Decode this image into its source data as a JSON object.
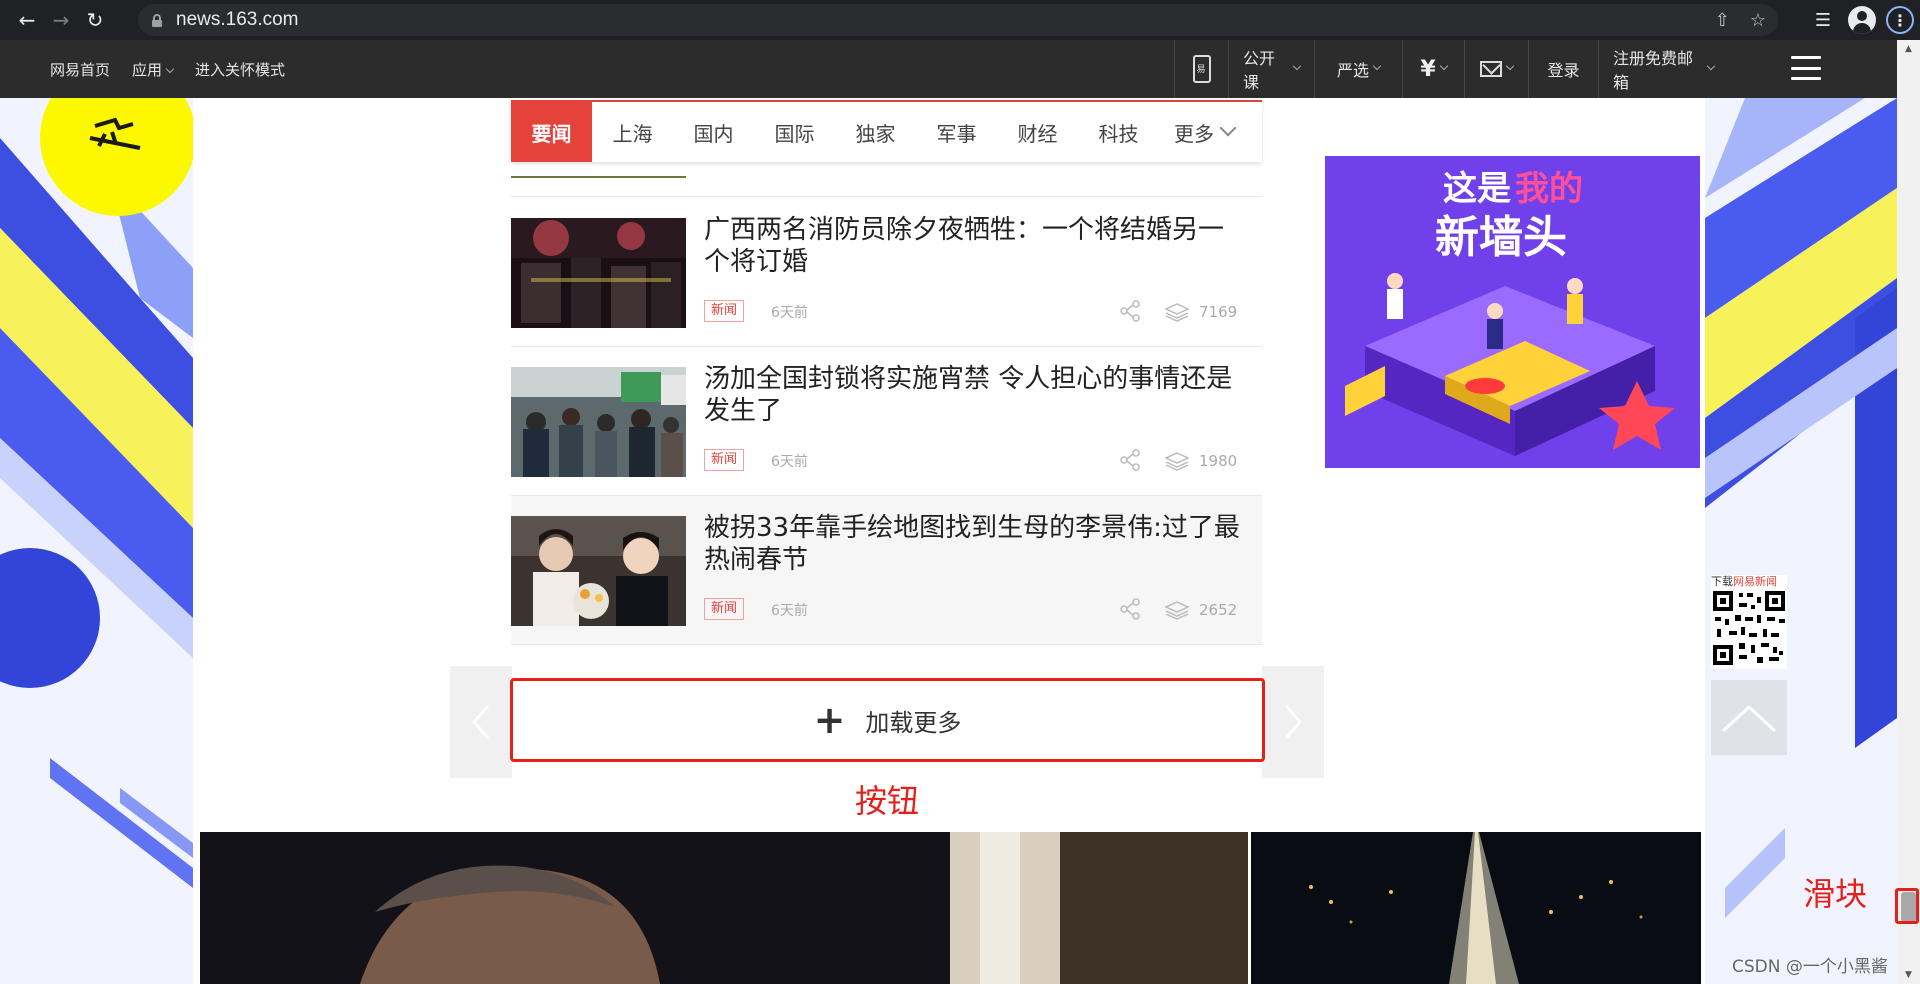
{
  "browser": {
    "url": "news.163.com",
    "icons": [
      "back-icon",
      "forward-icon",
      "reload-icon",
      "lock-icon",
      "share-page-icon",
      "bookmark-star-icon",
      "reading-list-icon",
      "profile-icon",
      "menu-icon"
    ]
  },
  "site_nav": {
    "left_items": [
      {
        "label": "网易首页"
      },
      {
        "label": "应用"
      },
      {
        "label": "进入关怀模式"
      }
    ],
    "right_items": [
      {
        "label": "公开课"
      },
      {
        "label": "严选"
      },
      {
        "label": "登录"
      },
      {
        "label": "注册免费邮箱"
      }
    ]
  },
  "tabs": [
    {
      "label": "要闻",
      "active": true
    },
    {
      "label": "上海"
    },
    {
      "label": "国内"
    },
    {
      "label": "国际"
    },
    {
      "label": "独家"
    },
    {
      "label": "军事"
    },
    {
      "label": "财经"
    },
    {
      "label": "科技"
    },
    {
      "label": "更多"
    }
  ],
  "news": [
    {
      "title": "广西两名消防员除夕夜牺牲：一个将结婚另一个将订婚",
      "tag": "新闻",
      "time": "6天前",
      "views": "7169"
    },
    {
      "title": "汤加全国封锁将实施宵禁 令人担心的事情还是发生了",
      "tag": "新闻",
      "time": "6天前",
      "views": "1980"
    },
    {
      "title": "被拐33年靠手绘地图找到生母的李景伟:过了最热闹春节",
      "tag": "新闻",
      "time": "6天前",
      "views": "2652"
    }
  ],
  "load_more": {
    "label": "加载更多"
  },
  "annotations": {
    "button": "按钮",
    "slider": "滑块"
  },
  "ad": {
    "line1": "这是",
    "line1_hl": "我的",
    "line2": "新墙头"
  },
  "qr": {
    "label_prefix": "下载",
    "label_brand": "网易新闻"
  },
  "watermark": "CSDN @一个小黑酱",
  "colors": {
    "brand_red": "#e5423b",
    "annotation_red": "#e5201b",
    "nav_bg": "#2c2c2c",
    "chrome_bg": "#202124"
  }
}
